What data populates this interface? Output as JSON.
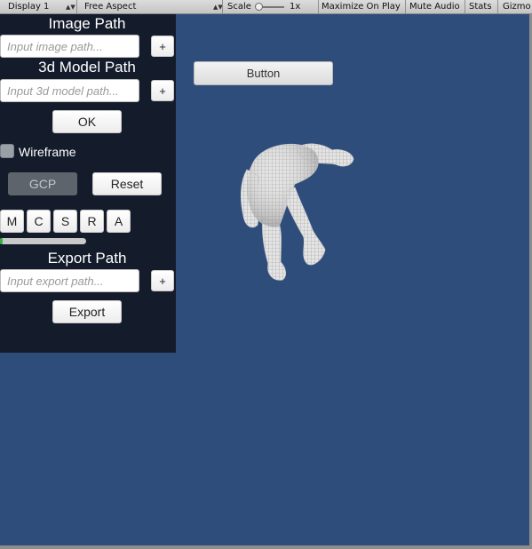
{
  "toolbar": {
    "display": "Display 1",
    "aspect": "Free Aspect",
    "scale_label": "Scale",
    "scale_value": "1x",
    "maximize": "Maximize On Play",
    "mute": "Mute Audio",
    "stats": "Stats",
    "gizmos": "Gizmo"
  },
  "panel": {
    "image_path": {
      "heading": "Image Path",
      "placeholder": "Input image path...",
      "add_label": "+"
    },
    "model_path": {
      "heading": "3d Model Path",
      "placeholder": "Input 3d model path...",
      "add_label": "+"
    },
    "ok_label": "OK",
    "wireframe_label": "Wireframe",
    "wireframe_checked": false,
    "gcp_label": "GCP",
    "reset_label": "Reset",
    "mode_buttons": [
      "M",
      "C",
      "S",
      "R",
      "A"
    ],
    "progress_fraction": 0.03,
    "export_path": {
      "heading": "Export Path",
      "placeholder": "Input export path...",
      "add_label": "+"
    },
    "export_label": "Export"
  },
  "scene": {
    "button_label": "Button",
    "background_color": "#2f4d7b",
    "panel_color": "#141c2b",
    "progress_color": "#3cb043"
  }
}
